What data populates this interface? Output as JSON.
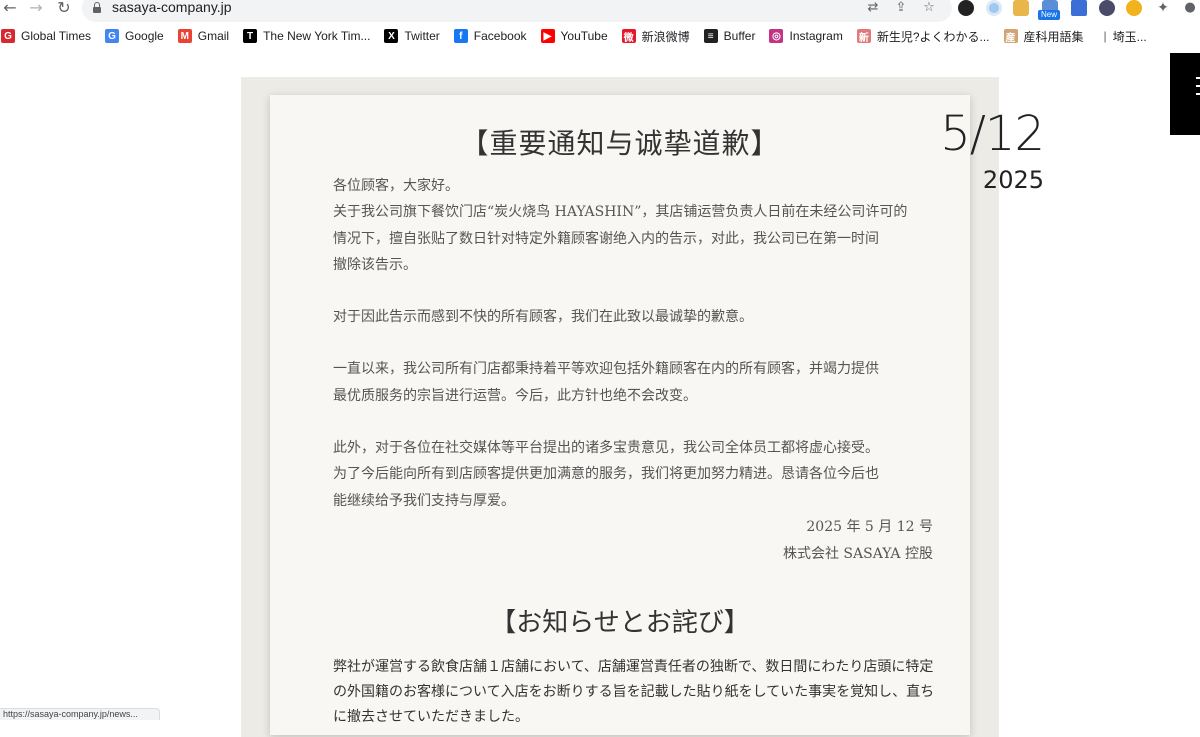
{
  "browser": {
    "url": "sasaya-company.jp",
    "status_url": "https://sasaya-company.jp/news...",
    "nav": {
      "back": "←",
      "forward": "→",
      "reload": "↻"
    },
    "new_badge": "New"
  },
  "bookmarks": [
    {
      "label": "Global Times",
      "icon": "global-times-icon",
      "color": "#d7282f",
      "glyph": "G"
    },
    {
      "label": "Google",
      "icon": "google-icon",
      "color": "#4285f4",
      "glyph": "G"
    },
    {
      "label": "Gmail",
      "icon": "gmail-icon",
      "color": "#ea4335",
      "glyph": "M"
    },
    {
      "label": "The New York Tim...",
      "icon": "nyt-icon",
      "color": "#000000",
      "glyph": "T"
    },
    {
      "label": "Twitter",
      "icon": "x-icon",
      "color": "#000000",
      "glyph": "X"
    },
    {
      "label": "Facebook",
      "icon": "facebook-icon",
      "color": "#1877f2",
      "glyph": "f"
    },
    {
      "label": "YouTube",
      "icon": "youtube-icon",
      "color": "#ff0000",
      "glyph": "▶"
    },
    {
      "label": "新浪微博",
      "icon": "weibo-icon",
      "color": "#e6162d",
      "glyph": "微"
    },
    {
      "label": "Buffer",
      "icon": "buffer-icon",
      "color": "#222222",
      "glyph": "≡"
    },
    {
      "label": "Instagram",
      "icon": "instagram-icon",
      "color": "#c13584",
      "glyph": "◎"
    },
    {
      "label": "新生児?よくわかる...",
      "icon": "newborn-site-icon",
      "color": "#e07a7a",
      "glyph": "新"
    },
    {
      "label": "産科用語集",
      "icon": "glossary-icon",
      "color": "#d4a373",
      "glyph": "産"
    },
    {
      "label": "埼玉...",
      "icon": "saitama-icon",
      "color": "#999999",
      "glyph": ""
    }
  ],
  "bookmark_separator": "|",
  "notice": {
    "date_big": "5/12",
    "date_year": "2025",
    "cn_title": "【重要通知与诚挚道歉】",
    "cn_paragraphs": [
      [
        "各位顾客，大家好。",
        "关于我公司旗下餐饮门店“炭火烧鸟 HAYASHIN”，其店铺运营负责人日前在未经公司许可的",
        "情况下，擅自张贴了数日针对特定外籍顾客谢绝入内的告示，对此，我公司已在第一时间",
        "撤除该告示。"
      ],
      [
        "对于因此告示而感到不快的所有顾客，我们在此致以最诚挚的歉意。"
      ],
      [
        "一直以来，我公司所有门店都秉持着平等欢迎包括外籍顾客在内的所有顾客，并竭力提供",
        "最优质服务的宗旨进行运营。今后，此方针也绝不会改变。"
      ],
      [
        "此外，对于各位在社交媒体等平台提出的诸多宝贵意见，我公司全体员工都将虚心接受。",
        "为了今后能向所有到店顾客提供更加满意的服务，我们将更加努力精进。恳请各位今后也",
        "能继续给予我们支持与厚爱。"
      ]
    ],
    "cn_date": "2025 年 5 月 12 号",
    "cn_company": "株式会社 SASAYA 控股",
    "jp_title": "【お知らせとお詫び】",
    "jp_lines": [
      "弊社が運営する飲食店舗１店舗において、店舗運営責任者の独断で、数日間にわたり店頭に特定",
      "の外国籍のお客様について入店をお断りする旨を記載した貼り紙をしていた事実を覚知し、直ち",
      "に撤去させていただきました。"
    ]
  }
}
